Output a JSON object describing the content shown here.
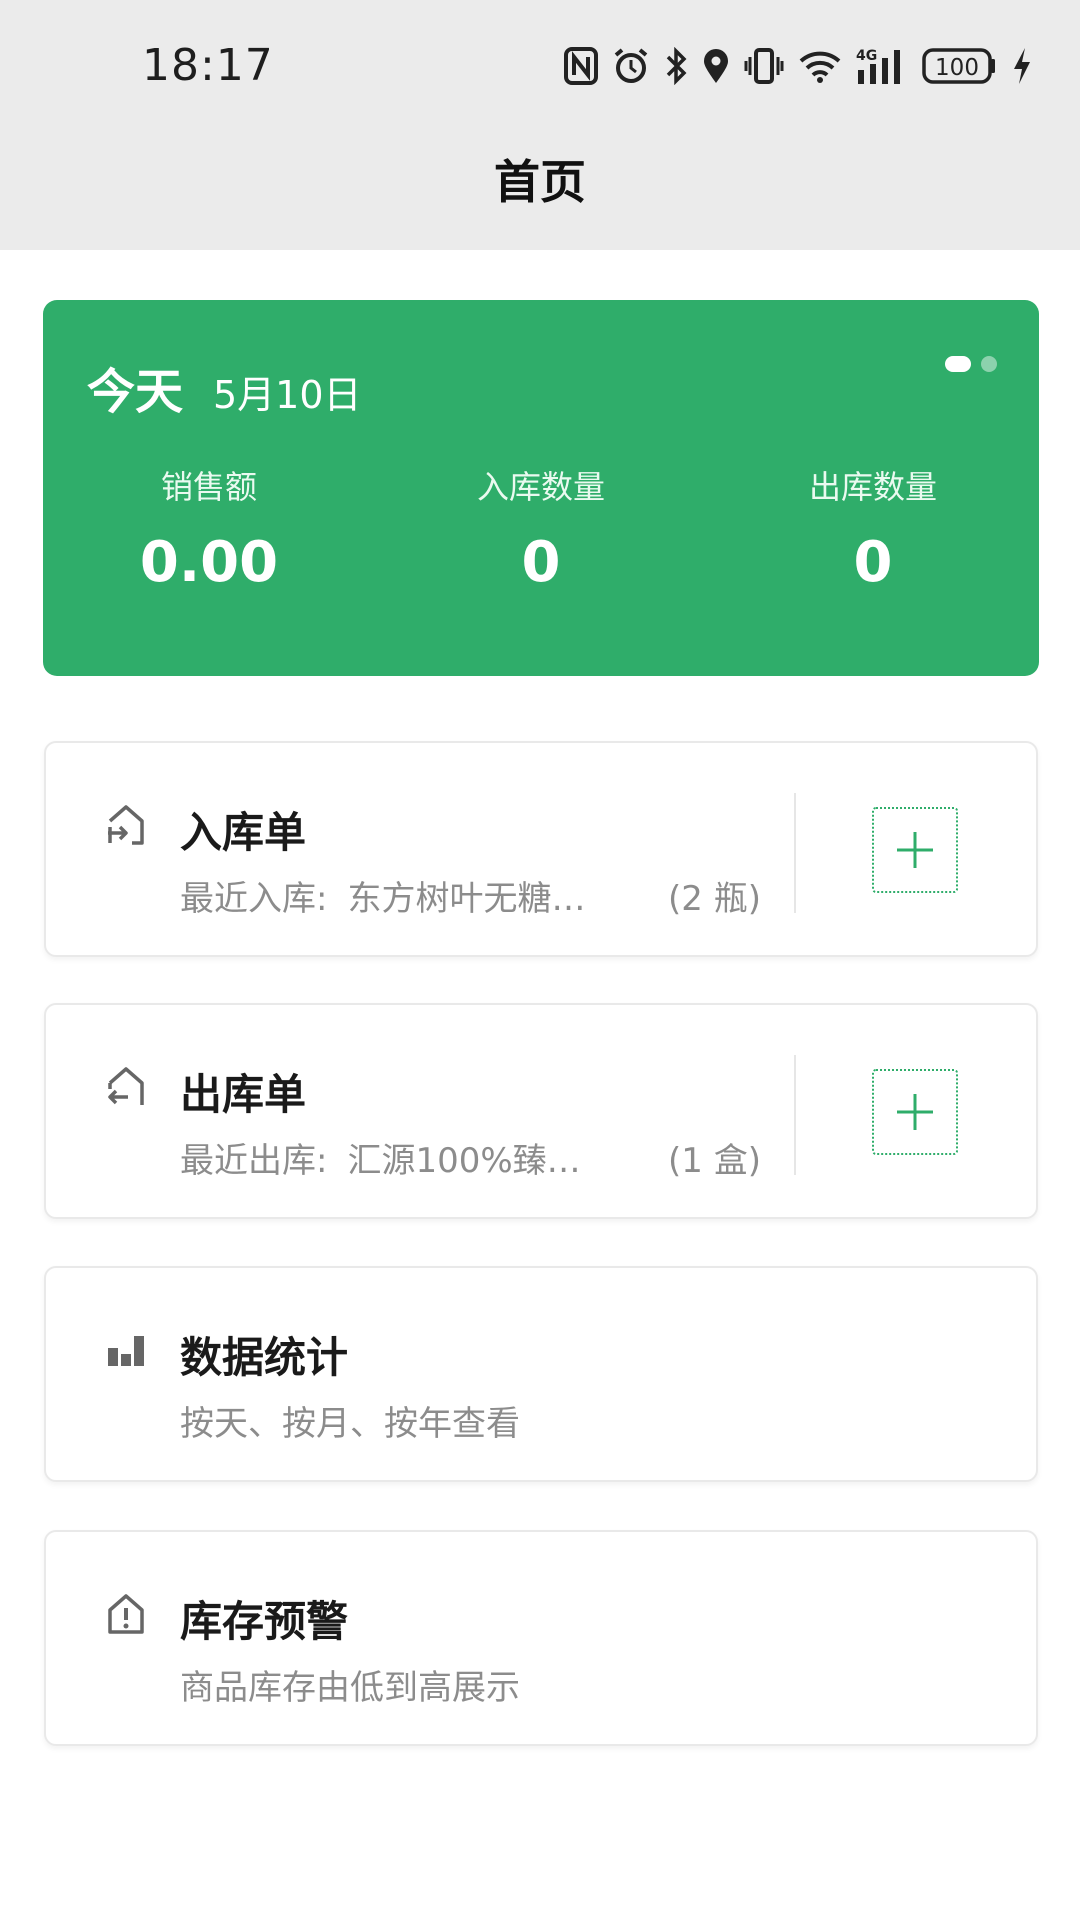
{
  "status_bar": {
    "time": "18:17",
    "network": "4G",
    "battery": "100",
    "icons": [
      "nfc-icon",
      "alarm-icon",
      "bluetooth-icon",
      "location-icon",
      "vibrate-icon",
      "wifi-icon",
      "signal-icon",
      "battery-icon",
      "charging-icon"
    ]
  },
  "header": {
    "title": "首页"
  },
  "today": {
    "label": "今天",
    "date": "5月10日",
    "stats": [
      {
        "label": "销售额",
        "value": "0.00"
      },
      {
        "label": "入库数量",
        "value": "0"
      },
      {
        "label": "出库数量",
        "value": "0"
      }
    ]
  },
  "cards": {
    "inbound": {
      "title": "入库单",
      "prefix": "最近入库:",
      "item": "东方树叶无糖…",
      "qty": "(2 瓶)"
    },
    "outbound": {
      "title": "出库单",
      "prefix": "最近出库:",
      "item": "汇源100%臻…",
      "qty": "(1 盒)"
    },
    "stats": {
      "title": "数据统计",
      "subtitle": "按天、按月、按年查看"
    },
    "warning": {
      "title": "库存预警",
      "subtitle": "商品库存由低到高展示"
    }
  },
  "colors": {
    "accent": "#2fad6a",
    "header_bg": "#ebebeb",
    "muted_text": "#8c8c8c"
  }
}
